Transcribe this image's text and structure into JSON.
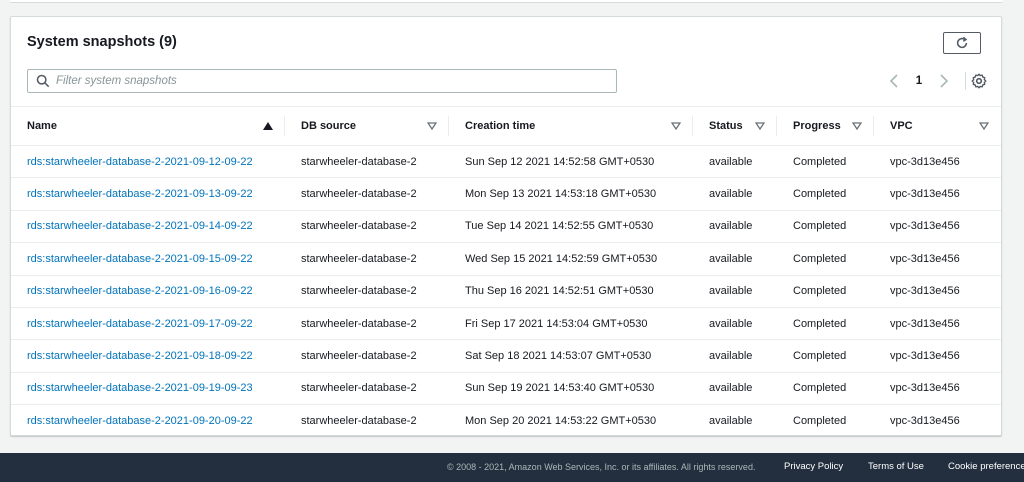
{
  "panel": {
    "title": "System snapshots (9)"
  },
  "search": {
    "placeholder": "Filter system snapshots",
    "value": ""
  },
  "pagination": {
    "current_page": "1"
  },
  "table": {
    "columns": [
      {
        "label": "Name",
        "sort": "ascending"
      },
      {
        "label": "DB source",
        "sort": "none"
      },
      {
        "label": "Creation time",
        "sort": "none"
      },
      {
        "label": "Status",
        "sort": "none"
      },
      {
        "label": "Progress",
        "sort": "none"
      },
      {
        "label": "VPC",
        "sort": "none"
      }
    ],
    "rows": [
      {
        "name": "rds:starwheeler-database-2-2021-09-12-09-22",
        "db_source": "starwheeler-database-2",
        "creation_time": "Sun Sep 12 2021 14:52:58 GMT+0530",
        "status": "available",
        "progress": "Completed",
        "vpc": "vpc-3d13e456"
      },
      {
        "name": "rds:starwheeler-database-2-2021-09-13-09-22",
        "db_source": "starwheeler-database-2",
        "creation_time": "Mon Sep 13 2021 14:53:18 GMT+0530",
        "status": "available",
        "progress": "Completed",
        "vpc": "vpc-3d13e456"
      },
      {
        "name": "rds:starwheeler-database-2-2021-09-14-09-22",
        "db_source": "starwheeler-database-2",
        "creation_time": "Tue Sep 14 2021 14:52:55 GMT+0530",
        "status": "available",
        "progress": "Completed",
        "vpc": "vpc-3d13e456"
      },
      {
        "name": "rds:starwheeler-database-2-2021-09-15-09-22",
        "db_source": "starwheeler-database-2",
        "creation_time": "Wed Sep 15 2021 14:52:59 GMT+0530",
        "status": "available",
        "progress": "Completed",
        "vpc": "vpc-3d13e456"
      },
      {
        "name": "rds:starwheeler-database-2-2021-09-16-09-22",
        "db_source": "starwheeler-database-2",
        "creation_time": "Thu Sep 16 2021 14:52:51 GMT+0530",
        "status": "available",
        "progress": "Completed",
        "vpc": "vpc-3d13e456"
      },
      {
        "name": "rds:starwheeler-database-2-2021-09-17-09-22",
        "db_source": "starwheeler-database-2",
        "creation_time": "Fri Sep 17 2021 14:53:04 GMT+0530",
        "status": "available",
        "progress": "Completed",
        "vpc": "vpc-3d13e456"
      },
      {
        "name": "rds:starwheeler-database-2-2021-09-18-09-22",
        "db_source": "starwheeler-database-2",
        "creation_time": "Sat Sep 18 2021 14:53:07 GMT+0530",
        "status": "available",
        "progress": "Completed",
        "vpc": "vpc-3d13e456"
      },
      {
        "name": "rds:starwheeler-database-2-2021-09-19-09-23",
        "db_source": "starwheeler-database-2",
        "creation_time": "Sun Sep 19 2021 14:53:40 GMT+0530",
        "status": "available",
        "progress": "Completed",
        "vpc": "vpc-3d13e456"
      },
      {
        "name": "rds:starwheeler-database-2-2021-09-20-09-22",
        "db_source": "starwheeler-database-2",
        "creation_time": "Mon Sep 20 2021 14:53:22 GMT+0530",
        "status": "available",
        "progress": "Completed",
        "vpc": "vpc-3d13e456"
      }
    ]
  },
  "footer": {
    "copyright": "© 2008 - 2021, Amazon Web Services, Inc. or its affiliates. All rights reserved.",
    "privacy_label": "Privacy Policy",
    "terms_label": "Terms of Use",
    "cookie_label": "Cookie preferences"
  },
  "icons": {
    "refresh": "refresh-icon",
    "search": "search-icon",
    "prev": "chevron-left-icon",
    "next": "chevron-right-icon",
    "settings": "gear-icon",
    "sort_asc": "sort-ascending-icon",
    "sort_none": "sort-descending-outline-icon"
  },
  "colors": {
    "link": "#0073bb",
    "footer_bg": "#232f3e",
    "border": "#d5dbdb"
  }
}
